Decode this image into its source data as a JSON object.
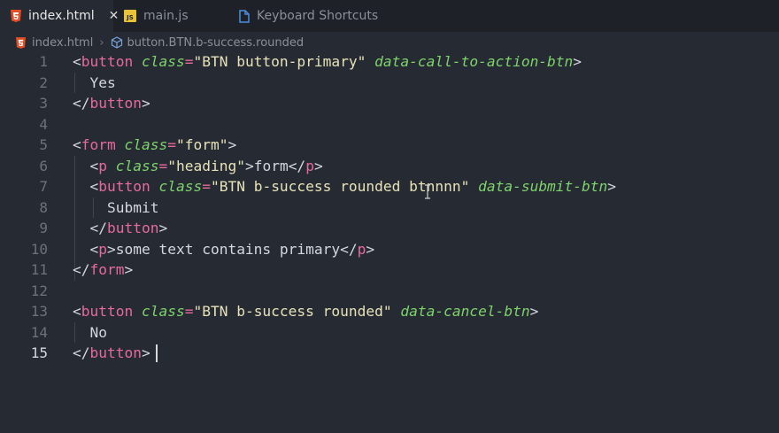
{
  "tabs": [
    {
      "label": "index.html",
      "icon": "html5-icon",
      "active": true
    },
    {
      "label": "main.js",
      "icon": "js-file-icon",
      "active": false
    },
    {
      "label": "Keyboard Shortcuts",
      "icon": "document-icon",
      "active": false
    }
  ],
  "breadcrumb": {
    "file": "index.html",
    "symbol": "button.BTN.b-success.rounded"
  },
  "editor": {
    "current_line": 15,
    "line_numbers": [
      "1",
      "2",
      "3",
      "4",
      "5",
      "6",
      "7",
      "8",
      "9",
      "10",
      "11",
      "12",
      "13",
      "14",
      "15"
    ],
    "lines": [
      [
        [
          "br",
          "<"
        ],
        [
          "tag",
          "button"
        ],
        [
          "sp",
          " "
        ],
        [
          "attr",
          "class"
        ],
        [
          "eq",
          "="
        ],
        [
          "str",
          "\"BTN button-primary\""
        ],
        [
          "sp",
          " "
        ],
        [
          "attr",
          "data-call-to-action-btn"
        ],
        [
          "br",
          ">"
        ]
      ],
      [
        [
          "txt",
          "  Yes"
        ]
      ],
      [
        [
          "br",
          "</"
        ],
        [
          "tag",
          "button"
        ],
        [
          "br",
          ">"
        ]
      ],
      [],
      [
        [
          "br",
          "<"
        ],
        [
          "tag",
          "form"
        ],
        [
          "sp",
          " "
        ],
        [
          "attr",
          "class"
        ],
        [
          "eq",
          "="
        ],
        [
          "str",
          "\"form\""
        ],
        [
          "br",
          ">"
        ]
      ],
      [
        [
          "sp",
          "  "
        ],
        [
          "br",
          "<"
        ],
        [
          "tag",
          "p"
        ],
        [
          "sp",
          " "
        ],
        [
          "attr",
          "class"
        ],
        [
          "eq",
          "="
        ],
        [
          "str",
          "\"heading\""
        ],
        [
          "br",
          ">"
        ],
        [
          "txt",
          "form"
        ],
        [
          "br",
          "</"
        ],
        [
          "tag",
          "p"
        ],
        [
          "br",
          ">"
        ]
      ],
      [
        [
          "sp",
          "  "
        ],
        [
          "br",
          "<"
        ],
        [
          "tag",
          "button"
        ],
        [
          "sp",
          " "
        ],
        [
          "attr",
          "class"
        ],
        [
          "eq",
          "="
        ],
        [
          "str",
          "\"BTN b-success rounded btnnnn\""
        ],
        [
          "sp",
          " "
        ],
        [
          "attr",
          "data-submit-btn"
        ],
        [
          "br",
          ">"
        ]
      ],
      [
        [
          "txt",
          "    Submit"
        ]
      ],
      [
        [
          "sp",
          "  "
        ],
        [
          "br",
          "</"
        ],
        [
          "tag",
          "button"
        ],
        [
          "br",
          ">"
        ]
      ],
      [
        [
          "sp",
          "  "
        ],
        [
          "br",
          "<"
        ],
        [
          "tag",
          "p"
        ],
        [
          "br",
          ">"
        ],
        [
          "txt",
          "some text contains primary"
        ],
        [
          "br",
          "</"
        ],
        [
          "tag",
          "p"
        ],
        [
          "br",
          ">"
        ]
      ],
      [
        [
          "br",
          "</"
        ],
        [
          "tag",
          "form"
        ],
        [
          "br",
          ">"
        ]
      ],
      [],
      [
        [
          "br",
          "<"
        ],
        [
          "tag",
          "button"
        ],
        [
          "sp",
          " "
        ],
        [
          "attr",
          "class"
        ],
        [
          "eq",
          "="
        ],
        [
          "str",
          "\"BTN b-success rounded\""
        ],
        [
          "sp",
          " "
        ],
        [
          "attr",
          "data-cancel-btn"
        ],
        [
          "br",
          ">"
        ]
      ],
      [
        [
          "txt",
          "  No"
        ]
      ],
      [
        [
          "br",
          "</"
        ],
        [
          "tag",
          "button"
        ],
        [
          "br",
          ">"
        ]
      ]
    ]
  },
  "colors": {
    "editor_bg": "#262a33",
    "tabbar_bg": "#1e2127",
    "tag": "#e66b9a",
    "attribute": "#7ed36c",
    "string": "#e7e2b8",
    "text": "#d4d7dd"
  }
}
